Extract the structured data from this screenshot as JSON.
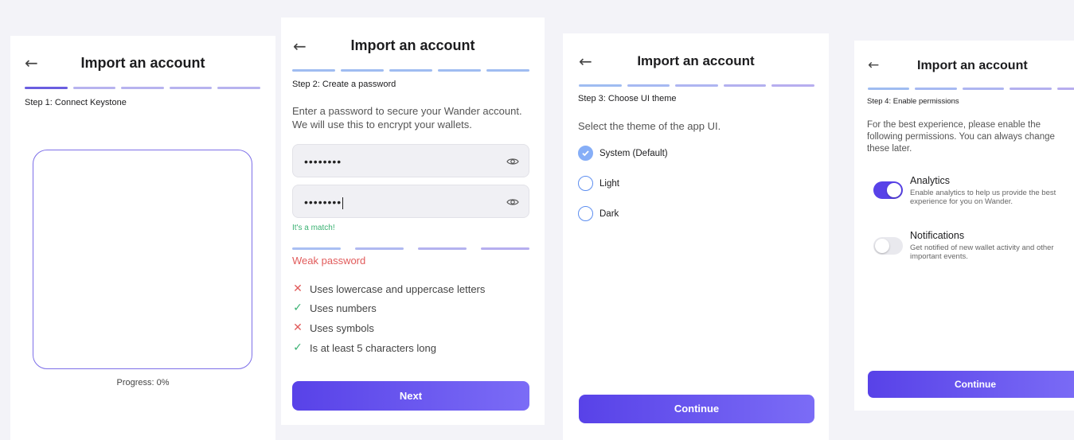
{
  "common": {
    "title": "Import an account",
    "back": "←"
  },
  "colors": {
    "accent": "#5842e8",
    "bar": "#b7b3ef",
    "error": "#e15b5b",
    "success": "#3bb273",
    "radio": "#86aef7"
  },
  "screen1": {
    "step": "Step 1: Connect Keystone",
    "progress": "Progress: 0%",
    "progress_value": 0
  },
  "screen2": {
    "step": "Step 2: Create a password",
    "intro": "Enter a password to secure your Wander account. We will use this to encrypt your wallets.",
    "password_value": "••••••••",
    "confirm_value": "••••••••",
    "match": "It's a match!",
    "strength": "Weak password",
    "requirements": [
      {
        "label": "Uses lowercase and uppercase letters",
        "met": false
      },
      {
        "label": "Uses numbers",
        "met": true
      },
      {
        "label": "Uses symbols",
        "met": false
      },
      {
        "label": "Is at least 5 characters long",
        "met": true
      }
    ],
    "button": "Next"
  },
  "screen3": {
    "step": "Step 3: Choose UI theme",
    "intro": "Select the theme of the app UI.",
    "options": [
      {
        "label": "System (Default)",
        "selected": true
      },
      {
        "label": "Light",
        "selected": false
      },
      {
        "label": "Dark",
        "selected": false
      }
    ],
    "button": "Continue"
  },
  "screen4": {
    "step": "Step 4: Enable permissions",
    "intro": "For the best experience, please enable the following permissions. You can always change these later.",
    "permissions": [
      {
        "title": "Analytics",
        "desc": "Enable analytics to help us provide the best experience for you on Wander.",
        "enabled": true
      },
      {
        "title": "Notifications",
        "desc": "Get notified of new wallet activity and other important events.",
        "enabled": false
      }
    ],
    "button": "Continue"
  }
}
